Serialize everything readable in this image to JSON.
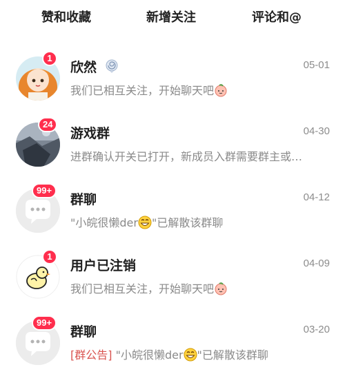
{
  "tabs": [
    "赞和收藏",
    "新增关注",
    "评论和@"
  ],
  "conversations": [
    {
      "name": "欣然",
      "date": "05-01",
      "badge": "1",
      "message": "我们已相互关注，开始聊天吧",
      "avatar_icon": "anime-girl-avatar",
      "name_icon": "spiral-shell-icon"
    },
    {
      "name": "游戏群",
      "date": "04-30",
      "badge": "24",
      "message": "进群确认开关已打开，新成员入群需要群主或…",
      "avatar_icon": "photo-avatar"
    },
    {
      "name": "群聊",
      "date": "04-12",
      "badge": "99+",
      "message_before": "\"小皖很懒der",
      "message_after": "\"已解散该群聊",
      "avatar_icon": "chat-bubble-avatar"
    },
    {
      "name": "用户已注销",
      "date": "04-09",
      "badge": "1",
      "message": "我们已相互关注，开始聊天吧",
      "avatar_icon": "chick-avatar"
    },
    {
      "name": "群聊",
      "date": "03-20",
      "badge": "99+",
      "tag": "[群公告]",
      "message_before": "\"小皖很懒der",
      "message_after": "\"已解散该群聊",
      "avatar_icon": "chat-bubble-avatar"
    }
  ],
  "colors": {
    "badge": "#ff2e4d",
    "tag": "#d9534f",
    "secondary_text": "#8a8a8a"
  }
}
